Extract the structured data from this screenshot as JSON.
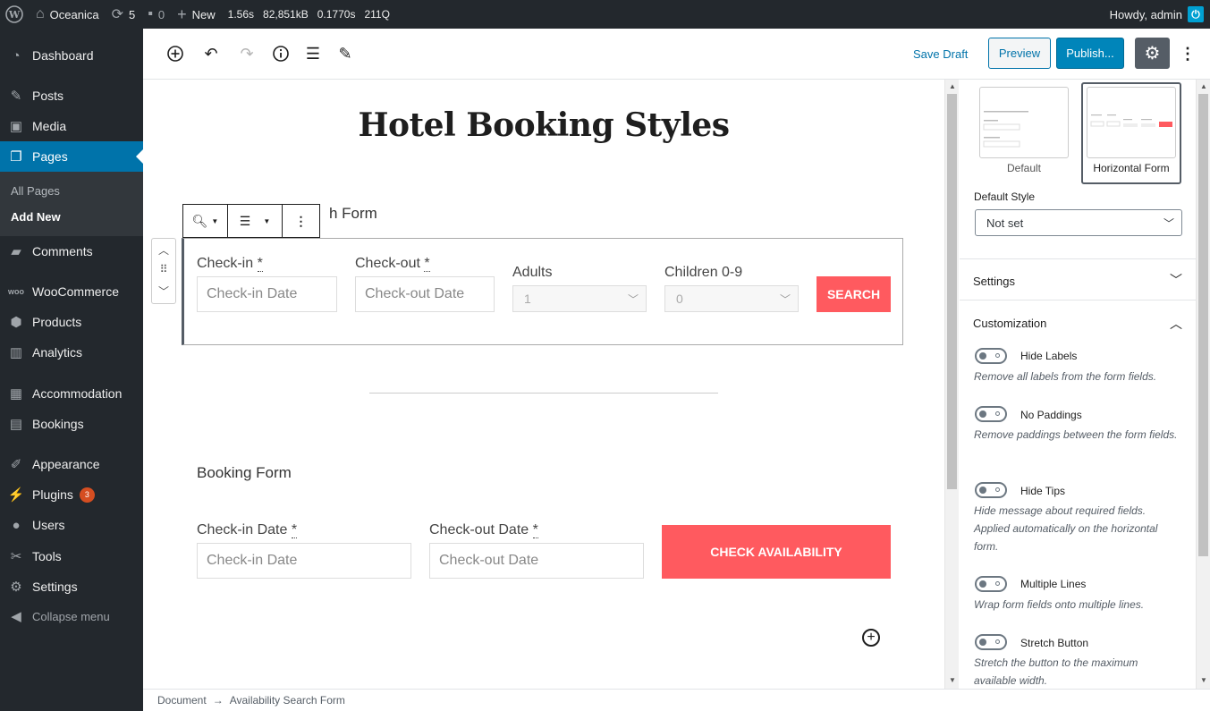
{
  "adminbar": {
    "site_name": "Oceanica",
    "updates_count": "5",
    "comments_count": "0",
    "new_label": "New",
    "stat_time": "1.56s",
    "stat_memory": "82,851kB",
    "stat_query_time": "0.1770s",
    "stat_queries": "211Q",
    "howdy": "Howdy, admin"
  },
  "sidebar": {
    "items": [
      {
        "label": "Dashboard",
        "icon": "dashboard-icon"
      },
      {
        "label": "Posts",
        "icon": "pin-icon"
      },
      {
        "label": "Media",
        "icon": "media-icon"
      },
      {
        "label": "Pages",
        "icon": "pages-icon"
      },
      {
        "label": "Comments",
        "icon": "comments-icon"
      },
      {
        "label": "WooCommerce",
        "icon": "woocommerce-icon"
      },
      {
        "label": "Products",
        "icon": "products-icon"
      },
      {
        "label": "Analytics",
        "icon": "analytics-icon"
      },
      {
        "label": "Accommodation",
        "icon": "building-icon"
      },
      {
        "label": "Bookings",
        "icon": "calendar-icon"
      },
      {
        "label": "Appearance",
        "icon": "brush-icon"
      },
      {
        "label": "Plugins",
        "icon": "plugin-icon",
        "badge": "3"
      },
      {
        "label": "Users",
        "icon": "users-icon"
      },
      {
        "label": "Tools",
        "icon": "wrench-icon"
      },
      {
        "label": "Settings",
        "icon": "settings-icon"
      }
    ],
    "submenu": [
      "All Pages",
      "Add New"
    ],
    "collapse_label": "Collapse menu"
  },
  "toolbar": {
    "save_draft": "Save Draft",
    "preview": "Preview",
    "publish": "Publish..."
  },
  "content": {
    "page_title": "Hotel Booking Styles",
    "search_form": {
      "title_visible": "h Form",
      "checkin_label": "Check-in",
      "checkout_label": "Check-out",
      "adults_label": "Adults",
      "children_label": "Children 0-9",
      "required_mark": "*",
      "checkin_placeholder": "Check-in Date",
      "checkout_placeholder": "Check-out Date",
      "adults_value": "1",
      "children_value": "0",
      "search_button": "SEARCH"
    },
    "booking_form": {
      "title": "Booking Form",
      "checkin_label": "Check-in Date",
      "checkout_label": "Check-out Date",
      "required_mark": "*",
      "checkin_placeholder": "Check-in Date",
      "checkout_placeholder": "Check-out Date",
      "button": "CHECK AVAILABILITY"
    }
  },
  "panel": {
    "styles": [
      {
        "name": "Default",
        "selected": false
      },
      {
        "name": "Horizontal Form",
        "selected": true
      }
    ],
    "default_style_label": "Default Style",
    "default_style_value": "Not set",
    "settings_heading": "Settings",
    "customization_heading": "Customization",
    "toggles": [
      {
        "label": "Hide Labels",
        "help": "Remove all labels from the form fields."
      },
      {
        "label": "No Paddings",
        "help": "Remove paddings between the form fields."
      },
      {
        "label": "Hide Tips",
        "help": "Hide message about required fields. Applied automatically on the horizontal form."
      },
      {
        "label": "Multiple Lines",
        "help": "Wrap form fields onto multiple lines."
      },
      {
        "label": "Stretch Button",
        "help": "Stretch the button to the maximum available width."
      }
    ]
  },
  "footer": {
    "breadcrumb_root": "Document",
    "breadcrumb_arrow": "→",
    "breadcrumb_current": "Availability Search Form"
  },
  "colors": {
    "accent": "#0073aa",
    "admin_dark": "#23282d",
    "cta_red": "#ff5a5f"
  }
}
